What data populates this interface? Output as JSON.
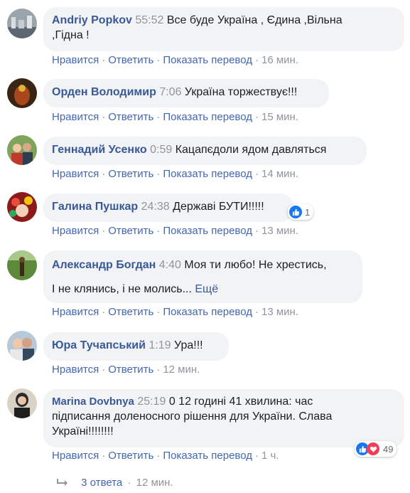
{
  "comments": [
    {
      "name": "Andriy Popkov",
      "time": "55:52",
      "text_line1": "Все буде Україна , Єдина ,Вільна",
      "text_line2": ",Гідна !",
      "like": "Нравится",
      "reply": "Ответить",
      "translate": "Показать перевод",
      "ago": "16 мин."
    },
    {
      "name": "Орден Володимир",
      "time": "7:06",
      "text": "Україна торжествує!!!",
      "like": "Нравится",
      "reply": "Ответить",
      "translate": "Показать перевод",
      "ago": "15 мин."
    },
    {
      "name": "Геннадий Усенко",
      "time": "0:59",
      "text": "Кацапєдоли ядом давляться",
      "like": "Нравится",
      "reply": "Ответить",
      "translate": "Показать перевод",
      "ago": "14 мин."
    },
    {
      "name": "Галина Пушкар",
      "time": "24:38",
      "text": "Державі БУТИ!!!!!",
      "reaction_count": "1",
      "like": "Нравится",
      "reply": "Ответить",
      "translate": "Показать перевод",
      "ago": "13 мин."
    },
    {
      "name": "Александр Богдан",
      "time": "4:40",
      "text_line1": "Моя ти любо! Не хрестись,",
      "text_line2": "І не клянись, і не молись...",
      "more": "Ещё",
      "like": "Нравится",
      "reply": "Ответить",
      "translate": "Показать перевод",
      "ago": "13 мин."
    },
    {
      "name": "Юра Тучапський",
      "time": "1:19",
      "text": "Ура!!!",
      "like": "Нравится",
      "reply": "Ответить",
      "ago": "12 мин."
    },
    {
      "name": "Marina Dovbnya",
      "time": "25:19",
      "text_line1": "0 12 годині 41 хвилина: час",
      "text_line2": "підписання доленосного рішення для України. Слава",
      "text_line3": "Україні!!!!!!!!",
      "reaction_count": "49",
      "like": "Нравится",
      "reply": "Ответить",
      "translate": "Показать перевод",
      "ago": "1 ч."
    }
  ],
  "replies_link": {
    "label": "3 ответа",
    "ago": "12 мин."
  },
  "colors": {
    "link": "#385898",
    "action": "#4267b2",
    "muted": "#90949c",
    "bubble": "#f2f3f5",
    "like": "#1877f2",
    "love": "#f33e58"
  }
}
